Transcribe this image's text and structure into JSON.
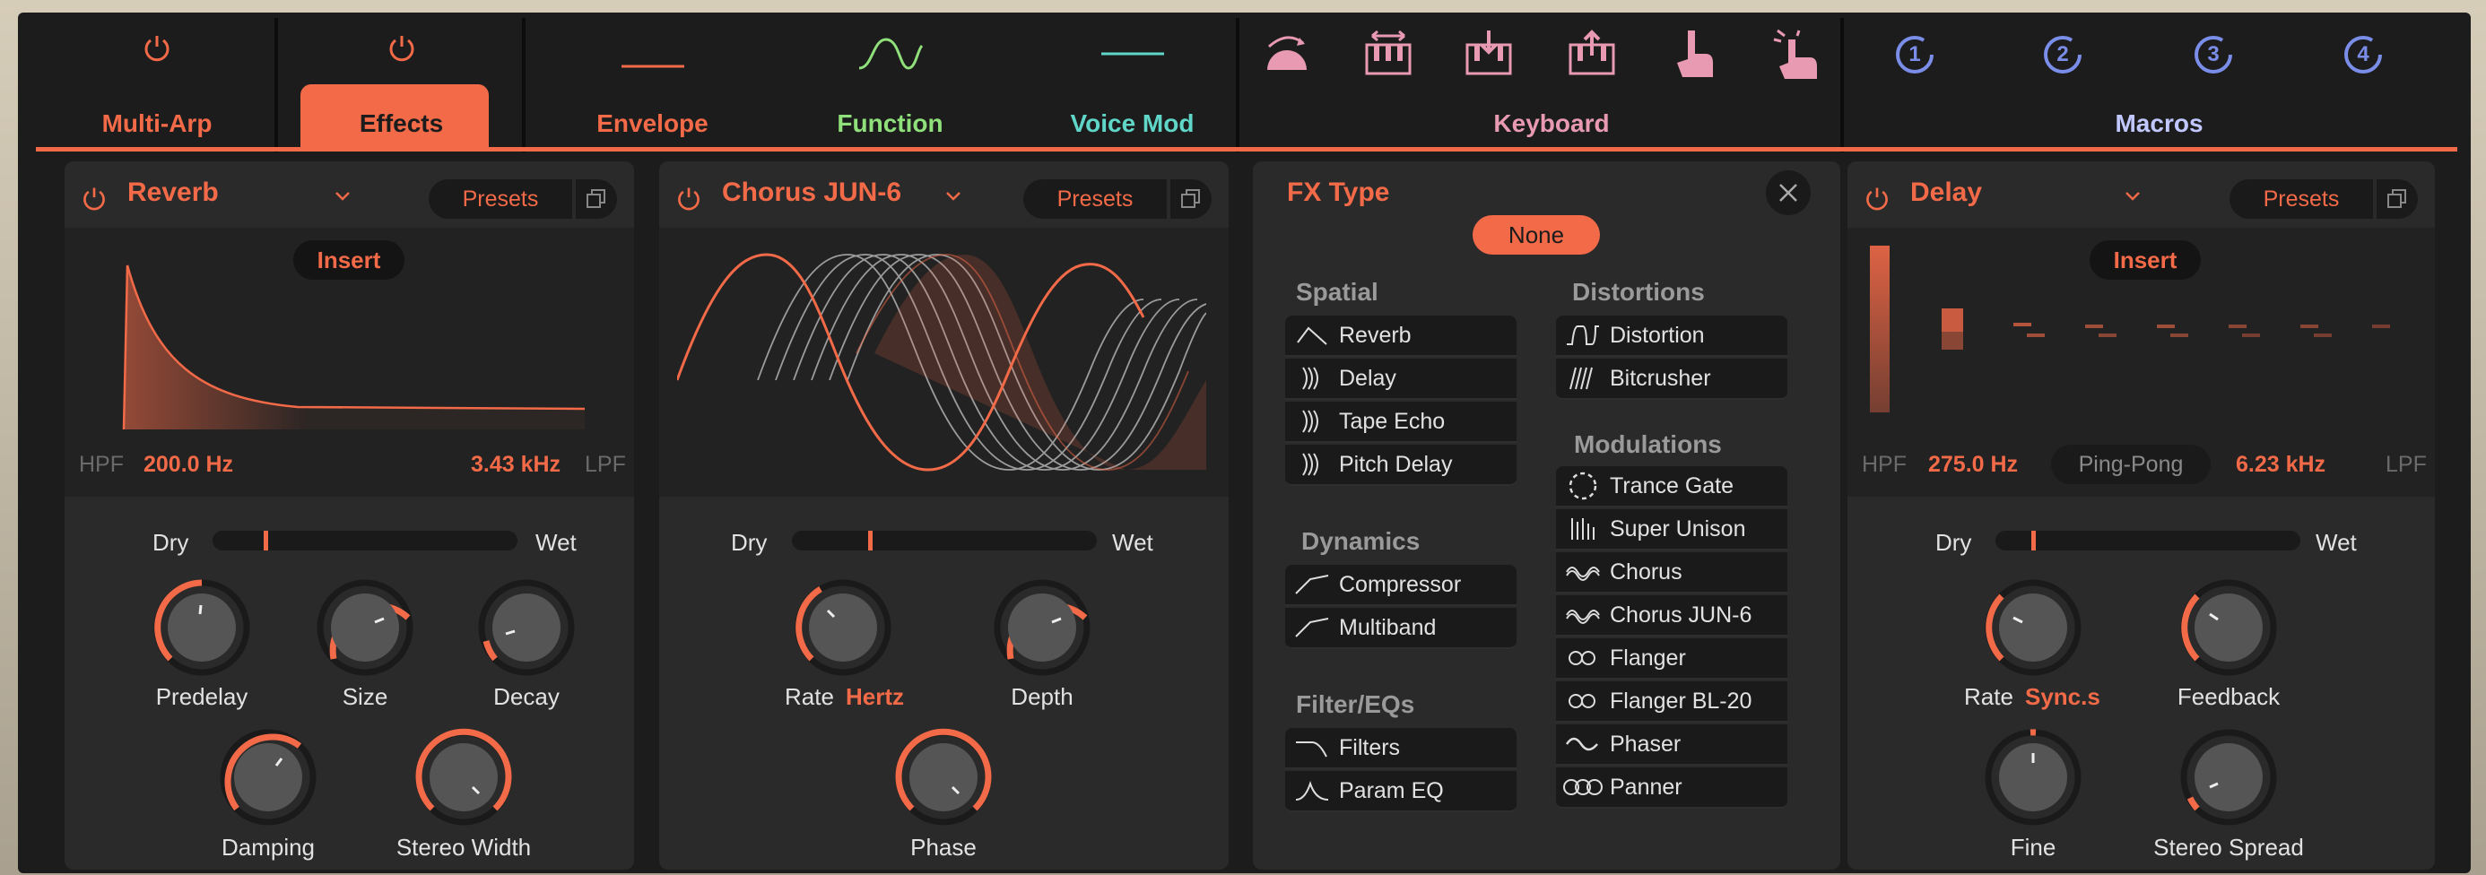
{
  "tabs": {
    "multi_arp": "Multi-Arp",
    "effects": "Effects",
    "envelope": "Envelope",
    "function": "Function",
    "voice_mod": "Voice Mod",
    "keyboard": "Keyboard",
    "macros": "Macros",
    "macro_numbers": [
      "1",
      "2",
      "3",
      "4"
    ]
  },
  "colors": {
    "accent": "#f26a48",
    "function": "#8fe07a",
    "voice_mod": "#5fd6c8",
    "keyboard": "#e89ab2",
    "macros": "#c0c8ff",
    "macro_circle": "#7a8de8"
  },
  "reverb": {
    "title": "Reverb",
    "presets": "Presets",
    "insert": "Insert",
    "hpf_label": "HPF",
    "hpf_value": "200.0 Hz",
    "lpf_value": "3.43 kHz",
    "lpf_label": "LPF",
    "dry": "Dry",
    "wet": "Wet",
    "drywet": 0.17,
    "knobs": [
      "Predelay",
      "Size",
      "Decay",
      "Damping",
      "Stereo Width"
    ]
  },
  "chorus": {
    "title": "Chorus JUN-6",
    "presets": "Presets",
    "dry": "Dry",
    "wet": "Wet",
    "drywet": 0.25,
    "rate": "Rate",
    "rate_unit": "Hertz",
    "depth": "Depth",
    "phase": "Phase"
  },
  "fx_type": {
    "title": "FX Type",
    "none": "None",
    "spatial": "Spatial",
    "spatial_items": [
      "Reverb",
      "Delay",
      "Tape Echo",
      "Pitch Delay"
    ],
    "dynamics": "Dynamics",
    "dynamics_items": [
      "Compressor",
      "Multiband"
    ],
    "filters": "Filter/EQs",
    "filters_items": [
      "Filters",
      "Param EQ"
    ],
    "distortions": "Distortions",
    "distortions_items": [
      "Distortion",
      "Bitcrusher"
    ],
    "modulations": "Modulations",
    "modulations_items": [
      "Trance Gate",
      "Super Unison",
      "Chorus",
      "Chorus JUN-6",
      "Flanger",
      "Flanger BL-20",
      "Phaser",
      "Panner"
    ]
  },
  "delay": {
    "title": "Delay",
    "presets": "Presets",
    "insert": "Insert",
    "hpf_label": "HPF",
    "hpf_value": "275.0 Hz",
    "mode": "Ping-Pong",
    "lpf_value": "6.23 kHz",
    "lpf_label": "LPF",
    "dry": "Dry",
    "wet": "Wet",
    "drywet": 0.12,
    "rate": "Rate",
    "rate_unit": "Sync.s",
    "feedback": "Feedback",
    "fine": "Fine",
    "stereo_spread": "Stereo Spread"
  }
}
